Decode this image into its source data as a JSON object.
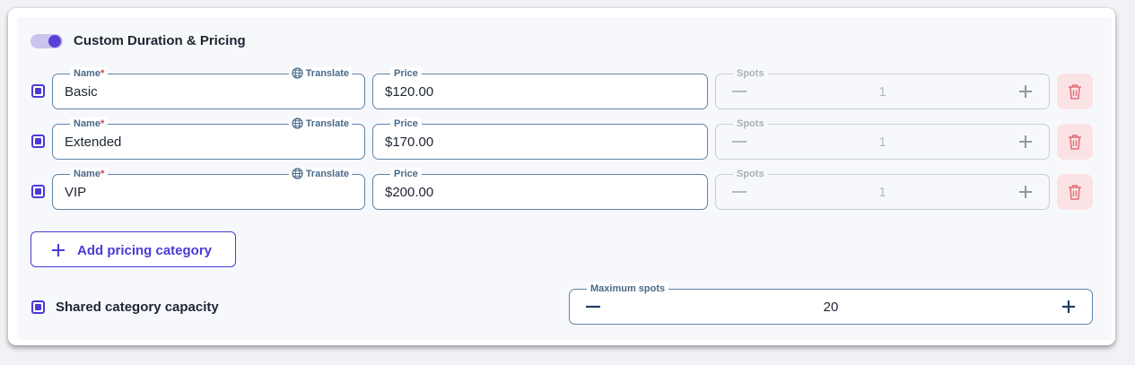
{
  "section": {
    "title": "Custom Duration & Pricing",
    "toggle_on": true
  },
  "labels": {
    "name": "Name",
    "required_mark": "*",
    "translate": "Translate",
    "price": "Price",
    "spots": "Spots"
  },
  "categories": [
    {
      "name": "Basic",
      "price": "$120.00",
      "spots": "1"
    },
    {
      "name": "Extended",
      "price": "$170.00",
      "spots": "1"
    },
    {
      "name": "VIP",
      "price": "$200.00",
      "spots": "1"
    }
  ],
  "add_button": {
    "label": "Add pricing category"
  },
  "shared_capacity": {
    "label": "Shared category capacity",
    "max_spots_label": "Maximum spots",
    "max_spots_value": "20"
  },
  "colors": {
    "accent": "#4a3ad6",
    "field_border": "#5e85a8",
    "delete_bg": "#fbe3e5",
    "delete_icon": "#e0707a"
  },
  "icons": {
    "translate": "globe-icon",
    "delete": "trash-icon",
    "decrement": "minus-icon",
    "increment": "plus-icon"
  }
}
